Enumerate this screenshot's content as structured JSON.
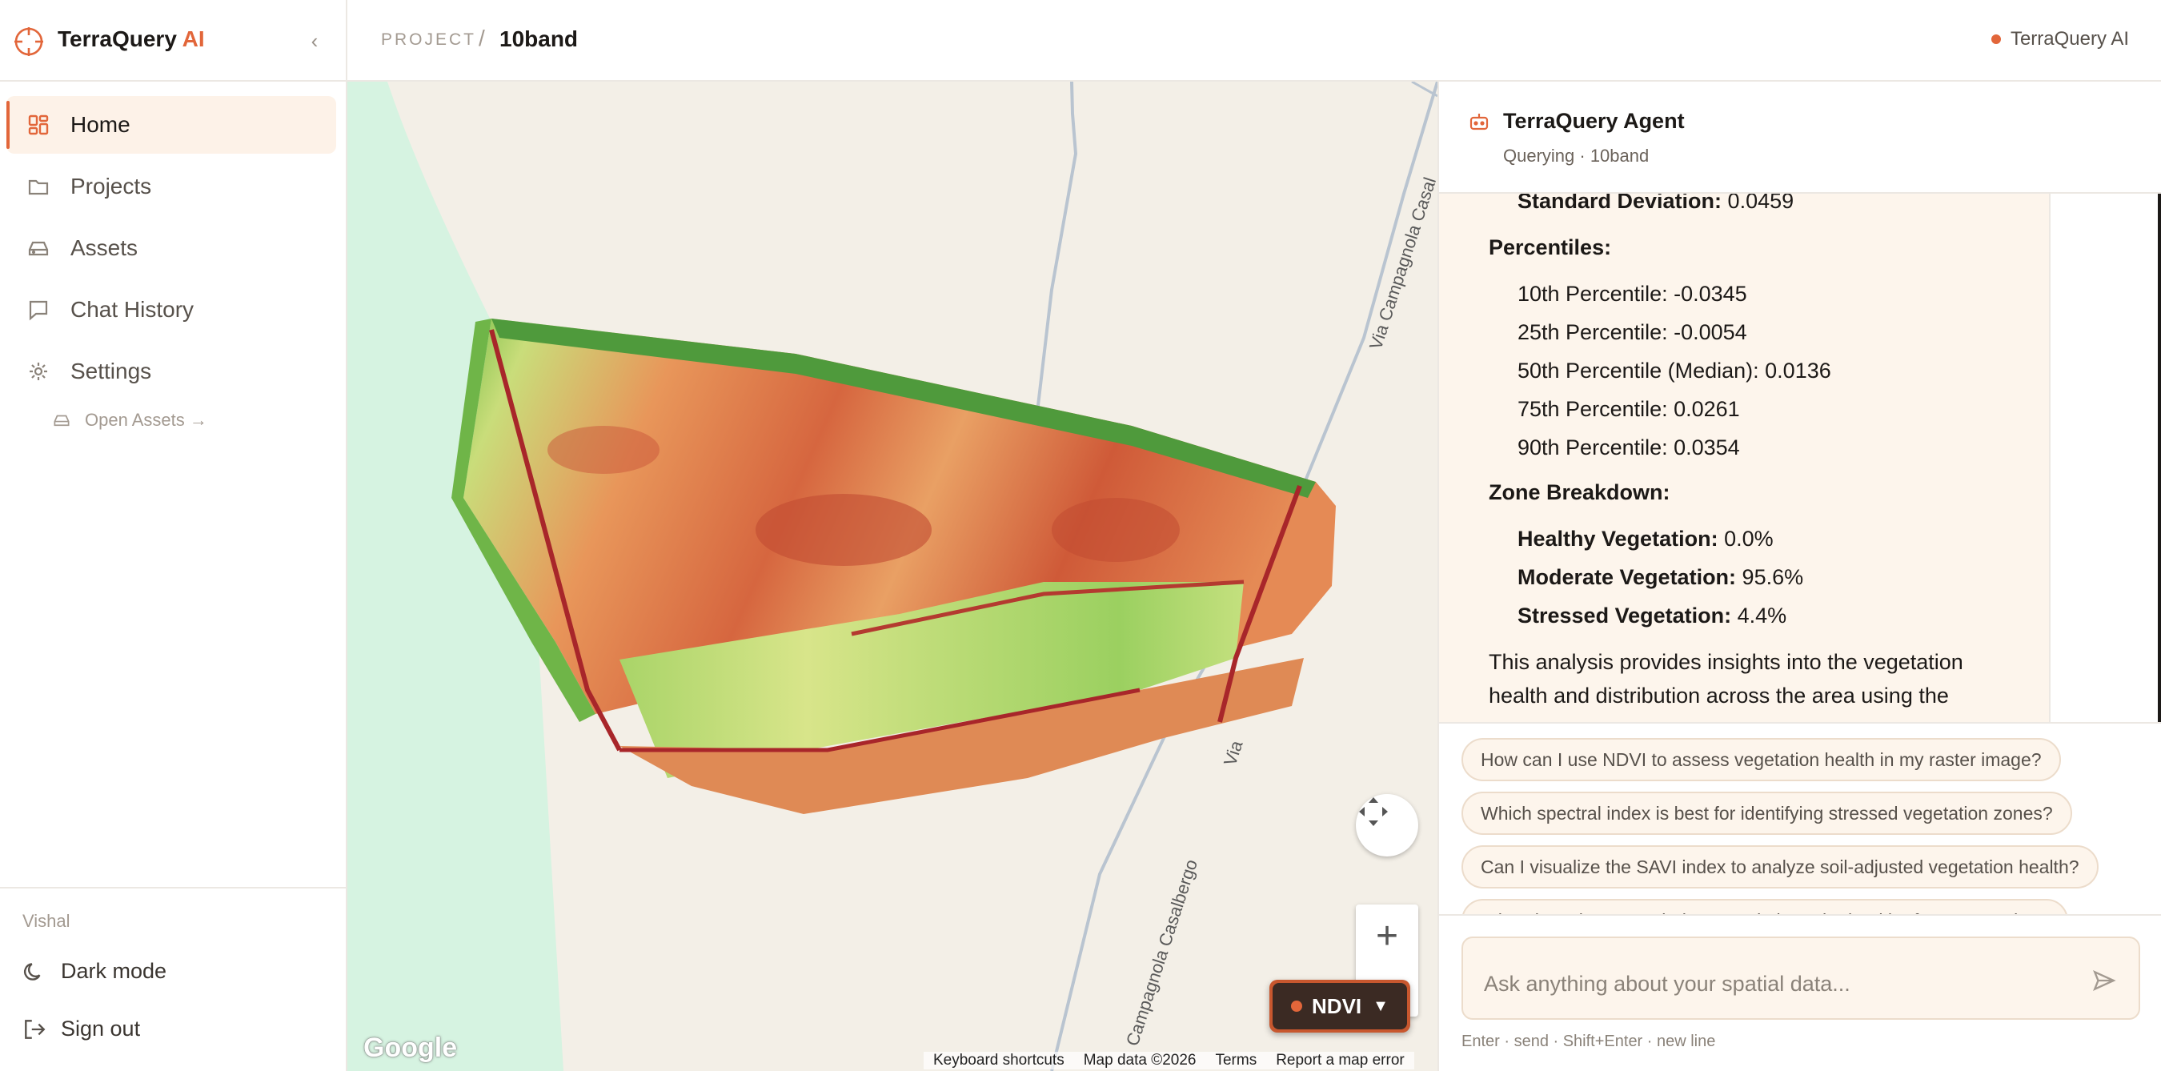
{
  "brand": {
    "name": "TerraQuery",
    "accent": "AI"
  },
  "sidebar": {
    "items": [
      {
        "label": "Home",
        "icon": "grid-icon",
        "active": true
      },
      {
        "label": "Projects",
        "icon": "folder-icon"
      },
      {
        "label": "Assets",
        "icon": "drive-icon"
      },
      {
        "label": "Chat History",
        "icon": "chat-icon"
      },
      {
        "label": "Settings",
        "icon": "gear-icon"
      }
    ],
    "sub_link": "Open Assets →",
    "user": "Vishal",
    "dark_mode": "Dark mode",
    "sign_out": "Sign out"
  },
  "header": {
    "project_label": "PROJECT",
    "separator": "/",
    "project_name": "10band",
    "app_badge": "TerraQuery AI"
  },
  "map": {
    "roads": [
      "Via Campagnola Casal",
      "Via",
      "Campagnola Casalbergo"
    ],
    "layer_button": "NDVI",
    "google_logo": "Google",
    "footer": [
      "Keyboard shortcuts",
      "Map data ©2026",
      "Terms",
      "Report a map error"
    ]
  },
  "agent": {
    "title": "TerraQuery Agent",
    "subtitle": "Querying · 10band",
    "message": {
      "std_label": "Standard Deviation:",
      "std_value": " 0.0459",
      "percentiles_heading": "Percentiles:",
      "p10": "10th Percentile: -0.0345",
      "p25": "25th Percentile: -0.0054",
      "p50": "50th Percentile (Median): 0.0136",
      "p75": "75th Percentile: 0.0261",
      "p90": "90th Percentile: 0.0354",
      "zone_heading": "Zone Breakdown:",
      "healthy_label": "Healthy Vegetation:",
      "healthy_value": " 0.0%",
      "moderate_label": "Moderate Vegetation:",
      "moderate_value": " 95.6%",
      "stressed_label": "Stressed Vegetation:",
      "stressed_value": " 4.4%",
      "summary_1": "This analysis provides insights into the vegetation",
      "summary_2": "health and distribution across the area using the"
    },
    "suggestions": [
      "How can I use NDVI to assess vegetation health in my raster image?",
      "Which spectral index is best for identifying stressed vegetation zones?",
      "Can I visualize the SAVI index to analyze soil-adjusted vegetation health?",
      "What does the NDRE index reveal about the health of my vegetation?"
    ],
    "input_placeholder": "Ask anything about your spatial data...",
    "hint": "Enter · send  ·  Shift+Enter · new line"
  },
  "colors": {
    "accent": "#e2663a",
    "panel_bg": "#fdf5ec",
    "map_bg": "#f3efe7"
  }
}
